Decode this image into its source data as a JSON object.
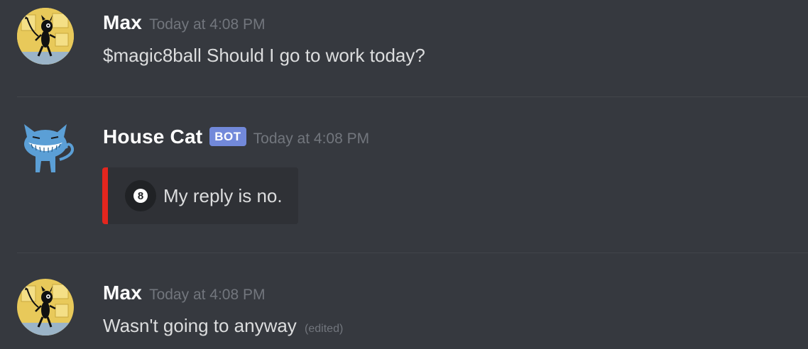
{
  "messages": [
    {
      "username": "Max",
      "timestamp": "Today at 4:08 PM",
      "content": "$magic8ball Should I go to work today?"
    },
    {
      "username": "House Cat",
      "bot_tag": "BOT",
      "timestamp": "Today at 4:08 PM",
      "embed": {
        "icon": "8",
        "text": "My reply is no.",
        "accent_color": "#e3261e"
      }
    },
    {
      "username": "Max",
      "timestamp": "Today at 4:08 PM",
      "content": "Wasn't going to anyway",
      "edited": "(edited)"
    }
  ],
  "colors": {
    "background": "#36393f",
    "username": "#ffffff",
    "timestamp": "#72767d",
    "text": "#dcddde",
    "bot_tag": "#7289da",
    "embed_bg": "#2f3136"
  }
}
